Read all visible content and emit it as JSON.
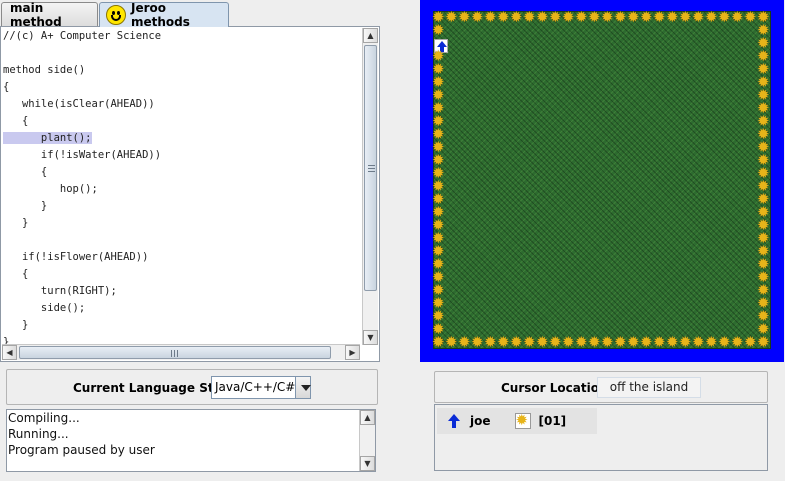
{
  "tabs": [
    {
      "label": "main method",
      "active": false
    },
    {
      "label": "Jeroo methods",
      "active": true,
      "icon": "smiley-icon"
    }
  ],
  "editor": {
    "lines": [
      "//(c) A+ Computer Science",
      "",
      "method side()",
      "{",
      "   while(isClear(AHEAD))",
      "   {",
      "      plant();",
      "      if(!isWater(AHEAD))",
      "      {",
      "         hop();",
      "      }",
      "   }",
      "",
      "   if(!isFlower(AHEAD))",
      "   {",
      "      turn(RIGHT);",
      "      side();",
      "   }",
      "}"
    ],
    "highlighted_line": 6,
    "highlight_color": "#c9c9ef"
  },
  "language": {
    "label": "Current Language Style",
    "selected": "Java/C++/C#"
  },
  "console": {
    "lines": [
      "Compiling...",
      "Running...",
      "Program paused by user"
    ]
  },
  "island": {
    "water_color": "#0000ff",
    "grass_color": "#2d6b2f",
    "flower_color": "#e7b41a",
    "jeroo_direction": "up",
    "flower_border": "all-edges"
  },
  "cursor": {
    "label": "Cursor Location",
    "value": "off the island"
  },
  "jeroo_status": {
    "name": "joe",
    "direction_icon": "arrow-up-icon",
    "flower_icon": "flower-icon",
    "flowers": "[01]"
  }
}
